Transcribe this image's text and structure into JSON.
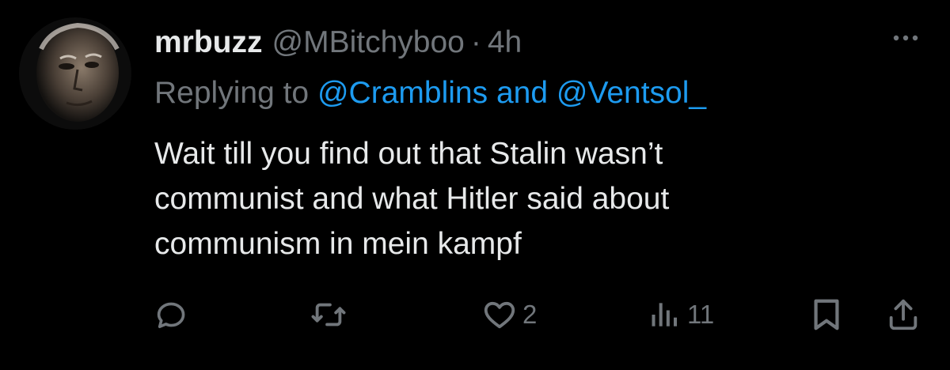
{
  "tweet": {
    "display_name": "mrbuzz",
    "handle": "@MBitchyboo",
    "separator": "·",
    "timestamp": "4h",
    "reply": {
      "prefix": "Replying to",
      "mentions": [
        "@Cramblins",
        "@Ventsol_"
      ],
      "joiner": "and"
    },
    "body_lines": [
      "Wait till you find out that Stalin wasn’t",
      "communist and what Hitler said about",
      "communism in mein kampf"
    ],
    "actions": {
      "reply_icon": "reply-icon",
      "retweet_icon": "retweet-icon",
      "like_icon": "heart-icon",
      "like_count": "2",
      "views_icon": "views-icon",
      "views_count": "11",
      "bookmark_icon": "bookmark-icon",
      "share_icon": "share-icon"
    },
    "more_icon": "more-icon"
  },
  "colors": {
    "background": "#000000",
    "text": "#e7e9ea",
    "secondary": "#71767b",
    "link": "#1d9bf0"
  }
}
